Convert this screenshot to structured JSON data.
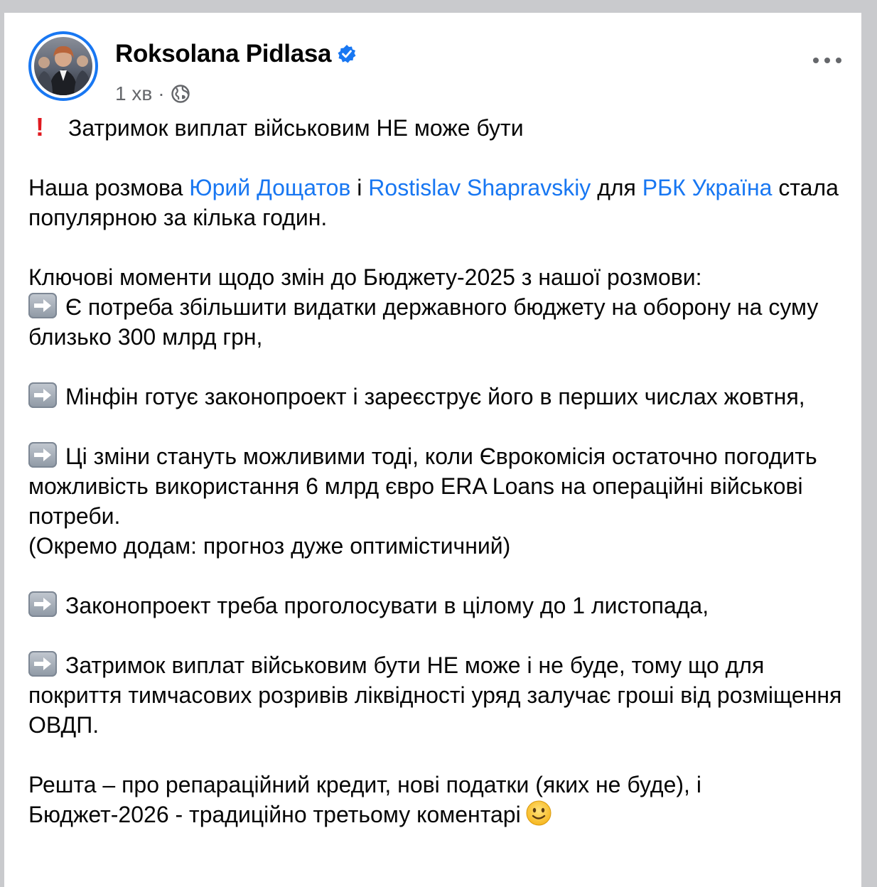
{
  "post": {
    "author": "Roksolana Pidlasa",
    "time": "1 хв",
    "separator": "·",
    "title_line": "Затримок виплат військовим НЕ може бути",
    "intro": {
      "t1": "Наша розмова ",
      "link1": "Юрий Дощатов",
      "t2": " і ",
      "link2": "Rostislav Shapravskiy",
      "t3": " для ",
      "link3": "РБК Україна",
      "t4": " стала популярною за кілька годин."
    },
    "key_points_heading": "Ключові моменти щодо змін до Бюджету-2025 з нашої розмови:",
    "points": [
      "Є потреба збільшити видатки державного бюджету на оборону на суму близько 300 млрд грн,",
      "Мінфін готує законопроект і зареєструє його в перших числах жовтня,",
      "Ці зміни стануть можливими тоді, коли Єврокомісія остаточно погодить можливість використання 6 млрд євро ERA Loans на операційні військові потреби.",
      "Законопроект треба проголосувати в цілому до 1 листопада,",
      "Затримок виплат військовим бути НЕ може і не буде, тому що для покриття тимчасових розривів ліквідності уряд залучає гроші від розміщення ОВДП."
    ],
    "point3_note": "(Окремо додам: прогноз дуже оптимістичний)",
    "closing": " Решта – про репараційний кредит, нові податки (яких не буде), і Бюджет-2026 - традиційно третьому коментарі"
  },
  "icons": {
    "verified": "verified-badge-icon",
    "privacy": "globe-icon",
    "more": "more-options-icon",
    "exclamation": "exclamation-emoji",
    "arrow": "right-arrow-emoji",
    "smile": "smiley-emoji"
  },
  "colors": {
    "link": "#1877f2",
    "meta": "#65676b",
    "text": "#050505"
  }
}
